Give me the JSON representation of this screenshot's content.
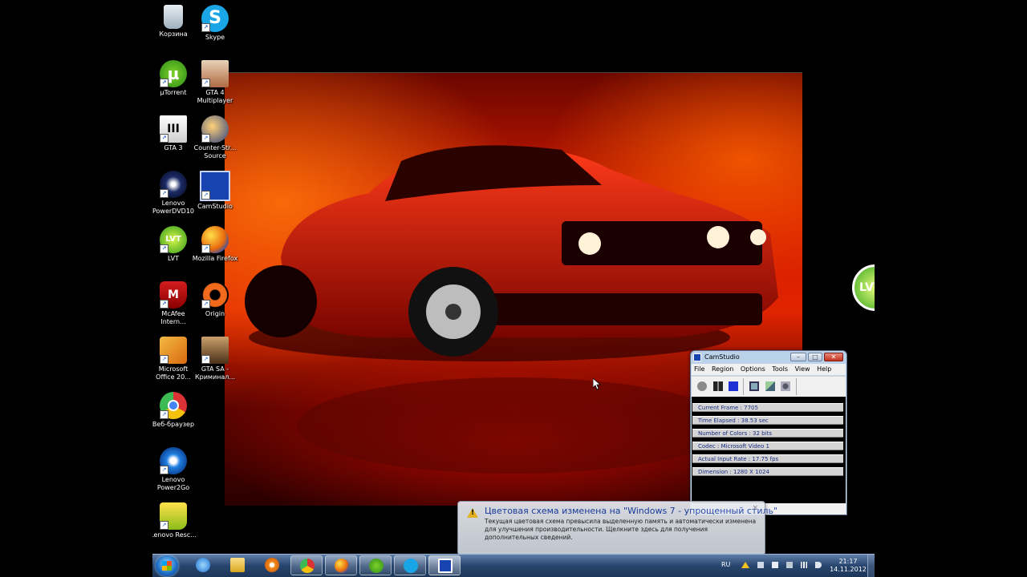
{
  "desktop_icons": [
    {
      "label": "Корзина",
      "icon": "recycle-bin-icon"
    },
    {
      "label": "Skype",
      "icon": "skype-icon"
    },
    {
      "label": "µTorrent",
      "icon": "utorrent-icon"
    },
    {
      "label": "GTA 4 Multiplayer",
      "icon": "gta4-icon"
    },
    {
      "label": "GTA 3",
      "icon": "gta3-icon"
    },
    {
      "label": "Counter-Str... Source",
      "icon": "counter-strike-icon"
    },
    {
      "label": "Lenovo PowerDVD10",
      "icon": "powerdvd-icon"
    },
    {
      "label": "CamStudio",
      "icon": "camstudio-icon"
    },
    {
      "label": "LVT",
      "icon": "lvt-icon"
    },
    {
      "label": "Mozilla Firefox",
      "icon": "firefox-icon"
    },
    {
      "label": "McAfee Intern...",
      "icon": "mcafee-icon"
    },
    {
      "label": "Origin",
      "icon": "origin-icon"
    },
    {
      "label": "Microsoft Office 20...",
      "icon": "office-icon"
    },
    {
      "label": "GTA SA - Криминал...",
      "icon": "gta-sa-icon"
    },
    {
      "label": "Веб-браузер",
      "icon": "chrome-icon"
    },
    {
      "label": "Lenovo Power2Go",
      "icon": "power2go-icon"
    },
    {
      "label": "Lenovo Resc...",
      "icon": "lenovo-rescue-icon"
    }
  ],
  "gadget": {
    "label": "LVT"
  },
  "camstudio": {
    "title": "CamStudio",
    "menu": [
      "File",
      "Region",
      "Options",
      "Tools",
      "View",
      "Help"
    ],
    "stats": [
      "Current Frame : 7705",
      "Time Elapsed : 38.53 sec",
      "Number of Colors : 32 bits",
      "Codec : Microsoft Video 1",
      "Actual Input Rate : 17.75 fps",
      "Dimension : 1280 X 1024"
    ]
  },
  "notification": {
    "title": "Цветовая схема изменена на \"Windows 7 - упрощенный стиль\"",
    "body": "Текущая цветовая схема превысила выделенную память и автоматически изменена для улучшения производительности. Щелкните здесь для получения дополнительных сведений.",
    "close": "×"
  },
  "taskbar": {
    "language": "RU",
    "time": "21:17",
    "date": "14.11.2012",
    "pinned": [
      "internet-explorer-icon",
      "explorer-folder-icon",
      "media-player-icon",
      "chrome-icon",
      "firefox-icon",
      "utorrent-icon",
      "skype-icon",
      "camstudio-icon"
    ]
  },
  "colors": {
    "taskbar": "#27456e",
    "camstudio_blue": "#1744b0",
    "notification_title": "#1b3fa6",
    "wallpaper_red": "#e12400"
  }
}
